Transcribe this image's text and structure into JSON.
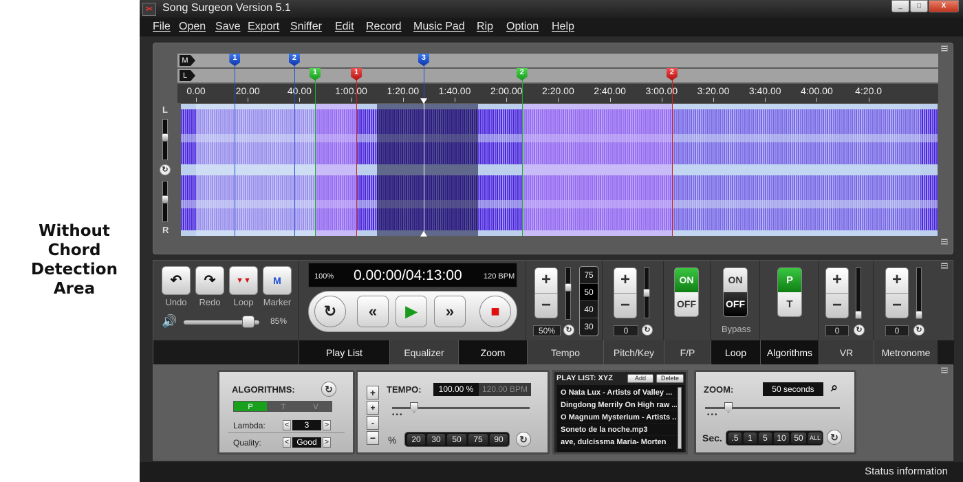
{
  "caption": [
    "Without",
    "Chord",
    "Detection",
    "Area"
  ],
  "window": {
    "title": "Song Surgeon Version 5.1",
    "controls": [
      "_",
      "□",
      "X"
    ]
  },
  "menu": [
    "File",
    "Open",
    "Save",
    "Export",
    "Sniffer",
    "Edit",
    "Record",
    "Music Pad",
    "Rip",
    "Option",
    "Help"
  ],
  "waveform": {
    "row_labels": {
      "markers": "M",
      "loops": "L"
    },
    "channel_labels": {
      "left": "L",
      "right": "R"
    },
    "time_ticks": [
      "0.00",
      "20.00",
      "40.00",
      "1:00.00",
      "1:20.00",
      "1:40.00",
      "2:00.00",
      "2:20.00",
      "2:40.00",
      "3:00.00",
      "3:20.00",
      "3:40.00",
      "4:00.00",
      "4:20.0"
    ],
    "time_ticks_seconds": [
      0,
      20,
      40,
      60,
      80,
      100,
      120,
      140,
      160,
      180,
      200,
      220,
      240,
      260
    ],
    "markers": [
      {
        "label": "1",
        "seconds": 15
      },
      {
        "label": "2",
        "seconds": 38
      },
      {
        "label": "3",
        "seconds": 88
      }
    ],
    "loop_starts": [
      {
        "label": "1",
        "seconds": 46
      },
      {
        "label": "2",
        "seconds": 126
      }
    ],
    "loop_ends": [
      {
        "label": "1",
        "seconds": 62
      },
      {
        "label": "2",
        "seconds": 184
      }
    ],
    "selection_seconds": [
      70,
      109
    ],
    "playhead_seconds": 88,
    "colors": {
      "marker": "#1a4fd6",
      "loop_start": "#1fae23",
      "loop_end": "#d41f1f",
      "wave": "#5a2de8"
    }
  },
  "edit_buttons": [
    {
      "label": "Undo",
      "icon": "undo-icon",
      "glyph": "↶"
    },
    {
      "label": "Redo",
      "icon": "redo-icon",
      "glyph": "↷"
    },
    {
      "label": "Loop",
      "icon": "loop-icon",
      "glyph": "▼▼"
    },
    {
      "label": "Marker",
      "icon": "marker-icon",
      "glyph": "M"
    }
  ],
  "volume": {
    "value": 0.85,
    "text": "85%",
    "icon": "speaker-icon"
  },
  "display": {
    "speed": "100%",
    "time": "0.00:00/04:13:00",
    "bpm": "120 BPM"
  },
  "transport": {
    "repeat": "↻",
    "rewind": "«",
    "play": "▶",
    "forward": "»",
    "stop": "■"
  },
  "tempo_ctrl": {
    "plus": "+",
    "minus": "−",
    "value": "50%",
    "options": [
      "75",
      "50",
      "40",
      "30"
    ],
    "selected": "50"
  },
  "pitch_ctrl": {
    "plus": "+",
    "minus": "−",
    "value": "0"
  },
  "fp_switch": {
    "on": "ON",
    "off": "OFF",
    "state": "on"
  },
  "loop_switch": {
    "on": "ON",
    "off": "OFF",
    "state": "off",
    "label": "Bypass"
  },
  "algo_switch": {
    "top": "P",
    "bottom": "T"
  },
  "vr_ctrl": {
    "plus": "+",
    "minus": "−",
    "value": "0"
  },
  "metronome_ctrl": {
    "plus": "+",
    "minus": "−",
    "value": "0"
  },
  "tabs": [
    "Play List",
    "Equalizer",
    "Zoom",
    "Tempo",
    "Pitch/Key",
    "F/P",
    "Loop",
    "Algorithms",
    "VR",
    "Metronome"
  ],
  "algorithms_card": {
    "title": "ALGORITHMS:",
    "modes": [
      "P",
      "T",
      "V"
    ],
    "lambda_label": "Lambda:",
    "lambda_value": "3",
    "quality_label": "Quality:",
    "quality_value": "Good",
    "prev": "<",
    "next": ">"
  },
  "tempo_card": {
    "title": "TEMPO:",
    "percent": "100.00 %",
    "bpm": "120.00 BPM",
    "percent_symbol": "%",
    "presets": [
      "20",
      "30",
      "50",
      "75",
      "90"
    ],
    "plus": "+",
    "minus": "−",
    "small_plus": "+",
    "small_minus": "-"
  },
  "playlist_card": {
    "title": "PLAY LIST: XYZ",
    "add": "Add",
    "delete": "Delete",
    "items": [
      "O Nata Lux - Artists of Valley ...",
      "Dingdong Merrily On High raw ...",
      "O Magnum Mysterium - Artists ...",
      "Soneto de la noche.mp3",
      "ave, dulcissma Maria- Morten"
    ]
  },
  "zoom_card": {
    "title": "ZOOM:",
    "value": "50 seconds",
    "sec_label": "Sec.",
    "presets": [
      ".5",
      "1",
      "5",
      "10",
      "50",
      "ALL"
    ]
  },
  "status": "Status information"
}
